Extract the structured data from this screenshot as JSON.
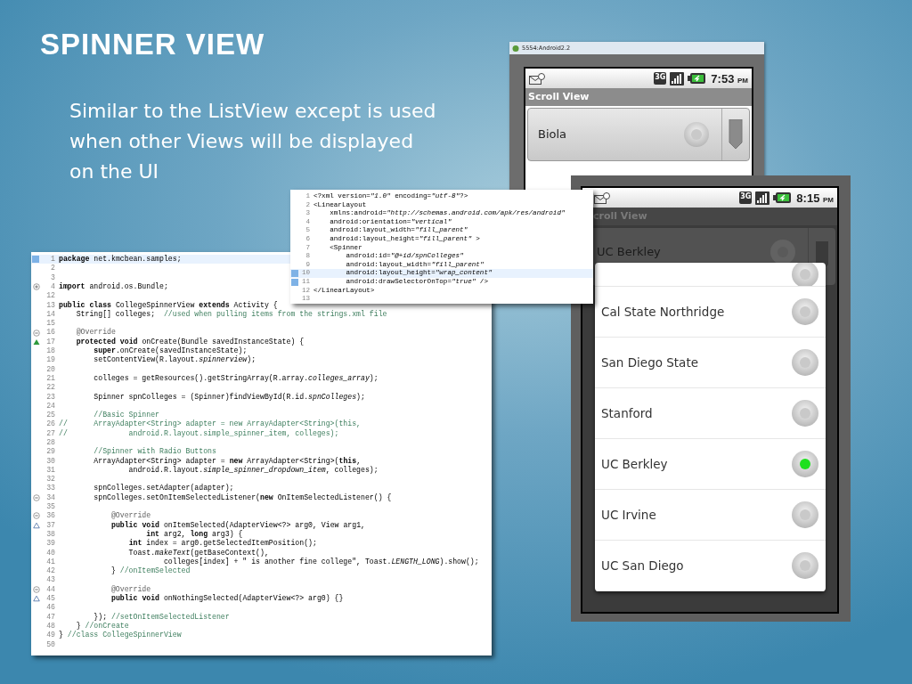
{
  "slide": {
    "title": "SPINNER VIEW",
    "body_lines": [
      "Similar to the ListView except is used",
      "when other Views will be displayed",
      "on the UI"
    ]
  },
  "emulator_1": {
    "window_title": "5554:Android2.2",
    "network_type": "3G",
    "time": "7:53",
    "time_suffix": "PM",
    "app_title": "Scroll View",
    "spinner": {
      "value": "Biola",
      "selected": false
    }
  },
  "emulator_2": {
    "network_type": "3G",
    "time": "8:15",
    "time_suffix": "PM",
    "app_title": "croll View",
    "spinner": {
      "value": "UC Berkley",
      "selected": false
    },
    "options": [
      {
        "selected": false
      },
      {
        "label": "Cal State Northridge",
        "selected": false
      },
      {
        "label": "San Diego State",
        "selected": false
      },
      {
        "label": "Stanford",
        "selected": false
      },
      {
        "label": "UC Berkley",
        "selected": true
      },
      {
        "label": "UC Irvine",
        "selected": false
      },
      {
        "label": "UC San Diego",
        "selected": false
      }
    ]
  },
  "java_editor": {
    "lines": [
      {
        "number": "1",
        "text": "**package** net.kmcbean.samples;",
        "current": true,
        "changed": true
      },
      {
        "number": "2",
        "current": false,
        "changed": false
      },
      {
        "number": "3",
        "current": false,
        "changed": false
      },
      {
        "number": "4",
        "text": "**import** android.os.Bundle;",
        "kind": "import",
        "current": false,
        "changed": false
      },
      {
        "number": "12",
        "current": false,
        "changed": false
      },
      {
        "number": "13",
        "text": "**public** **class** CollegeSpinnerView **extends** Activity {",
        "current": false,
        "changed": false
      },
      {
        "number": "14",
        "text": "    String[] colleges;  ",
        "comment": "//used when pulling items from the strings.xml file",
        "current": false,
        "changed": false
      },
      {
        "number": "15",
        "current": false,
        "changed": false
      },
      {
        "number": "16",
        "text": "    @Override",
        "kind": "annotation",
        "current": false,
        "changed": false
      },
      {
        "number": "17",
        "text": "    **protected** **void** onCreate(Bundle savedInstanceState) {",
        "kind": "override",
        "current": false,
        "changed": false
      },
      {
        "number": "18",
        "text": "        **super**.onCreate(savedInstanceState);",
        "current": false,
        "changed": false
      },
      {
        "number": "19",
        "text": "        setContentView(R.layout.*spinnerview*);",
        "current": false,
        "changed": false
      },
      {
        "number": "20",
        "current": false,
        "changed": false
      },
      {
        "number": "21",
        "text": "        colleges = getResources().getStringArray(R.array.*colleges_array*);",
        "current": false,
        "changed": false
      },
      {
        "number": "22",
        "current": false,
        "changed": false
      },
      {
        "number": "23",
        "text": "        Spinner spnColleges = (Spinner)findViewById(R.id.*spnColleges*);",
        "current": false,
        "changed": false
      },
      {
        "number": "24",
        "current": false,
        "changed": false
      },
      {
        "number": "25",
        "comment": "        //Basic Spinner",
        "current": false,
        "changed": false
      },
      {
        "number": "26",
        "comment": "//      ArrayAdapter<String> adapter = new ArrayAdapter<String>(this,",
        "current": false,
        "changed": false
      },
      {
        "number": "27",
        "comment": "//              android.R.layout.simple_spinner_item, colleges);",
        "current": false,
        "changed": false
      },
      {
        "number": "28",
        "current": false,
        "changed": false
      },
      {
        "number": "29",
        "comment": "        //Spinner with Radio Buttons",
        "current": false,
        "changed": false
      },
      {
        "number": "30",
        "text": "        ArrayAdapter<String> adapter = **new** ArrayAdapter<String>(**this**,",
        "current": false,
        "changed": false
      },
      {
        "number": "31",
        "text": "                android.R.layout.*simple_spinner_dropdown_item*, colleges);",
        "current": false,
        "changed": false
      },
      {
        "number": "32",
        "current": false,
        "changed": false
      },
      {
        "number": "33",
        "text": "        spnColleges.setAdapter(adapter);",
        "current": false,
        "changed": false
      },
      {
        "number": "34",
        "text": "        spnColleges.setOnItemSelectedListener(**new** OnItemSelectedListener() {",
        "kind": "block",
        "current": false,
        "changed": false
      },
      {
        "number": "35",
        "current": false,
        "changed": false
      },
      {
        "number": "36",
        "text": "            @Override",
        "kind": "annotation",
        "current": false,
        "changed": false
      },
      {
        "number": "37",
        "text": "            **public** **void** onItemSelected(AdapterView<?> arg0, View arg1,",
        "kind": "implement",
        "current": false,
        "changed": false
      },
      {
        "number": "38",
        "text": "                    **int** arg2, **long** arg3) {",
        "current": false,
        "changed": false
      },
      {
        "number": "39",
        "text": "                **int** index = arg0.getSelectedItemPosition();",
        "current": false,
        "changed": false
      },
      {
        "number": "40",
        "text": "                Toast.*makeText*(getBaseContext(),",
        "current": false,
        "changed": false
      },
      {
        "number": "41",
        "text": "                        colleges[index] + \" is another fine college\", Toast.*LENGTH_LONG*).show();",
        "current": false,
        "changed": false
      },
      {
        "number": "42",
        "text": "            } ",
        "comment": "//onItemSelected",
        "current": false,
        "changed": false
      },
      {
        "number": "43",
        "current": false,
        "changed": false
      },
      {
        "number": "44",
        "text": "            @Override",
        "kind": "annotation",
        "current": false,
        "changed": false
      },
      {
        "number": "45",
        "text": "            **public** **void** onNothingSelected(AdapterView<?> arg0) {}",
        "kind": "implement",
        "current": false,
        "changed": false
      },
      {
        "number": "46",
        "current": false,
        "changed": false
      },
      {
        "number": "47",
        "text": "        }); ",
        "comment": "//setOnItemSelectedListener",
        "current": false,
        "changed": false
      },
      {
        "number": "48",
        "text": "    } ",
        "comment": "//onCreate",
        "current": false,
        "changed": false
      },
      {
        "number": "49",
        "text": "} ",
        "comment": "//class CollegeSpinnerView",
        "current": false,
        "changed": false
      },
      {
        "number": "50",
        "current": false,
        "changed": false
      }
    ]
  },
  "xml_editor": {
    "lines": [
      {
        "number": "1",
        "text": "<?xml version=*\"1.0\"* encoding=*\"utf-8\"*?>",
        "current": false,
        "changed": false
      },
      {
        "number": "2",
        "text": "<LinearLayout",
        "current": false,
        "changed": false
      },
      {
        "number": "3",
        "text": "    xmlns:android=*\"http://schemas.android.com/apk/res/android\"*",
        "current": false,
        "changed": false
      },
      {
        "number": "4",
        "text": "    android:orientation=*\"vertical\"*",
        "current": false,
        "changed": false
      },
      {
        "number": "5",
        "text": "    android:layout_width=*\"fill_parent\"*",
        "current": false,
        "changed": false
      },
      {
        "number": "6",
        "text": "    android:layout_height=*\"fill_parent\"* >",
        "current": false,
        "changed": false
      },
      {
        "number": "7",
        "text": "    <Spinner",
        "current": false,
        "changed": false
      },
      {
        "number": "8",
        "text": "        android:id=*\"@+id/spnColleges\"*",
        "current": false,
        "changed": false
      },
      {
        "number": "9",
        "text": "        android:layout_width=*\"fill_parent\"*",
        "current": false,
        "changed": false
      },
      {
        "number": "10",
        "text": "        android:layout_height=*\"wrap_content\"*",
        "current": true,
        "changed": true
      },
      {
        "number": "11",
        "text": "        android:drawSelectorOnTop=*\"true\"* />",
        "current": false,
        "changed": true
      },
      {
        "number": "12",
        "text": "</LinearLayout>",
        "current": false,
        "changed": false
      },
      {
        "number": "13",
        "current": false,
        "changed": false
      }
    ]
  }
}
